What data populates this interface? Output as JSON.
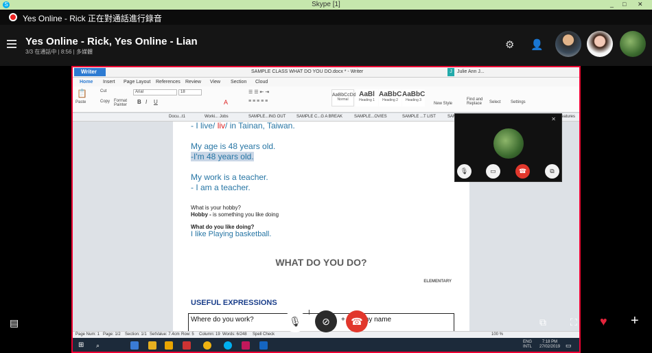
{
  "window": {
    "title": "Skype [1]",
    "controls": [
      "_",
      "□",
      "✕"
    ]
  },
  "recording": {
    "text": "Yes Online - Rick 正在對通話進行錄音"
  },
  "call_header": {
    "title": "Yes Online - Rick, Yes Online - Lian",
    "subtitle": "3/3 在通話中 | 8:56 | 多媒體",
    "participants": [
      {
        "color": "#c98f5a"
      },
      {
        "color": "#efb4a2"
      },
      {
        "color": "#4f8a3a"
      }
    ]
  },
  "writer": {
    "app_label": "Writer",
    "doc_title": "SAMPLE CLASS WHAT DO YOU DO.docx * - Writer",
    "user": "Julie Ann J...",
    "user_initial": "J",
    "menu_tabs": [
      "Home",
      "Insert",
      "Page Layout",
      "References",
      "Review",
      "View",
      "Section",
      "Cloud"
    ],
    "font_name": "Arial",
    "font_size": "18",
    "clipboard": {
      "paste": "Paste",
      "cut": "Cut",
      "copy": "Copy",
      "format_painter": "Format Painter"
    },
    "styles": [
      {
        "preview": "AaBbCcDd",
        "name": "Normal"
      },
      {
        "preview": "AaBl",
        "name": "Heading 1"
      },
      {
        "preview": "AaBbC",
        "name": "Heading 2"
      },
      {
        "preview": "AaBbC",
        "name": "Heading 3"
      }
    ],
    "new_style": "New Style",
    "find_replace": "Find and Replace",
    "select": "Select",
    "settings": "Settings",
    "doc_tabs": [
      "Docu...t1",
      "Worki... Jobs",
      "SAMPLE...ING OUT",
      "SAMPLE C...G A BREAK",
      "SAMPLE...OVIES",
      "SAMPLE ...T LIST",
      "SAM",
      "eatures"
    ],
    "statusbar": {
      "page_num": "Page Num: 1",
      "page": "Page: 1/2",
      "section": "Section: 1/1",
      "setvalue": "SetValue: 7.4cm",
      "row": "Row: 5",
      "column": "Column: 19",
      "words": "Words: 6/248",
      "spell": "Spell Check",
      "zoom": "100 %"
    }
  },
  "document": {
    "lines": [
      {
        "pre": "- I ",
        "w1": "live",
        "sep": "/ ",
        "w2": "liv",
        "post": "/ in Tainan, Taiwan."
      },
      "My age is 48 years old.",
      "-I'm 48 years old.",
      "My work is a teacher.",
      "- I am a teacher.",
      "What is your hobby?",
      {
        "bold": "Hobby - ",
        "rest": "is something you like doing"
      },
      "What do you like doing?",
      "I like Playing basketball."
    ],
    "heading": "WHAT DO YOU DO?",
    "level": "ELEMENTARY",
    "section": "USEFUL EXPRESSIONS",
    "table_cell": "Where do you work?",
    "table_cell_right": "work",
    "table_cell_right2": "+ c",
    "table_cell_right3": "my name"
  },
  "taskbar": {
    "lang": "ENG",
    "region": "INTL",
    "time": "7:18 PM",
    "date": "27/02/2019"
  },
  "colors": {
    "accent_red": "#e1372c",
    "skype_blue": "#00aff0",
    "doc_blue": "#2675a4",
    "heading_navy": "#1a3e8a"
  }
}
